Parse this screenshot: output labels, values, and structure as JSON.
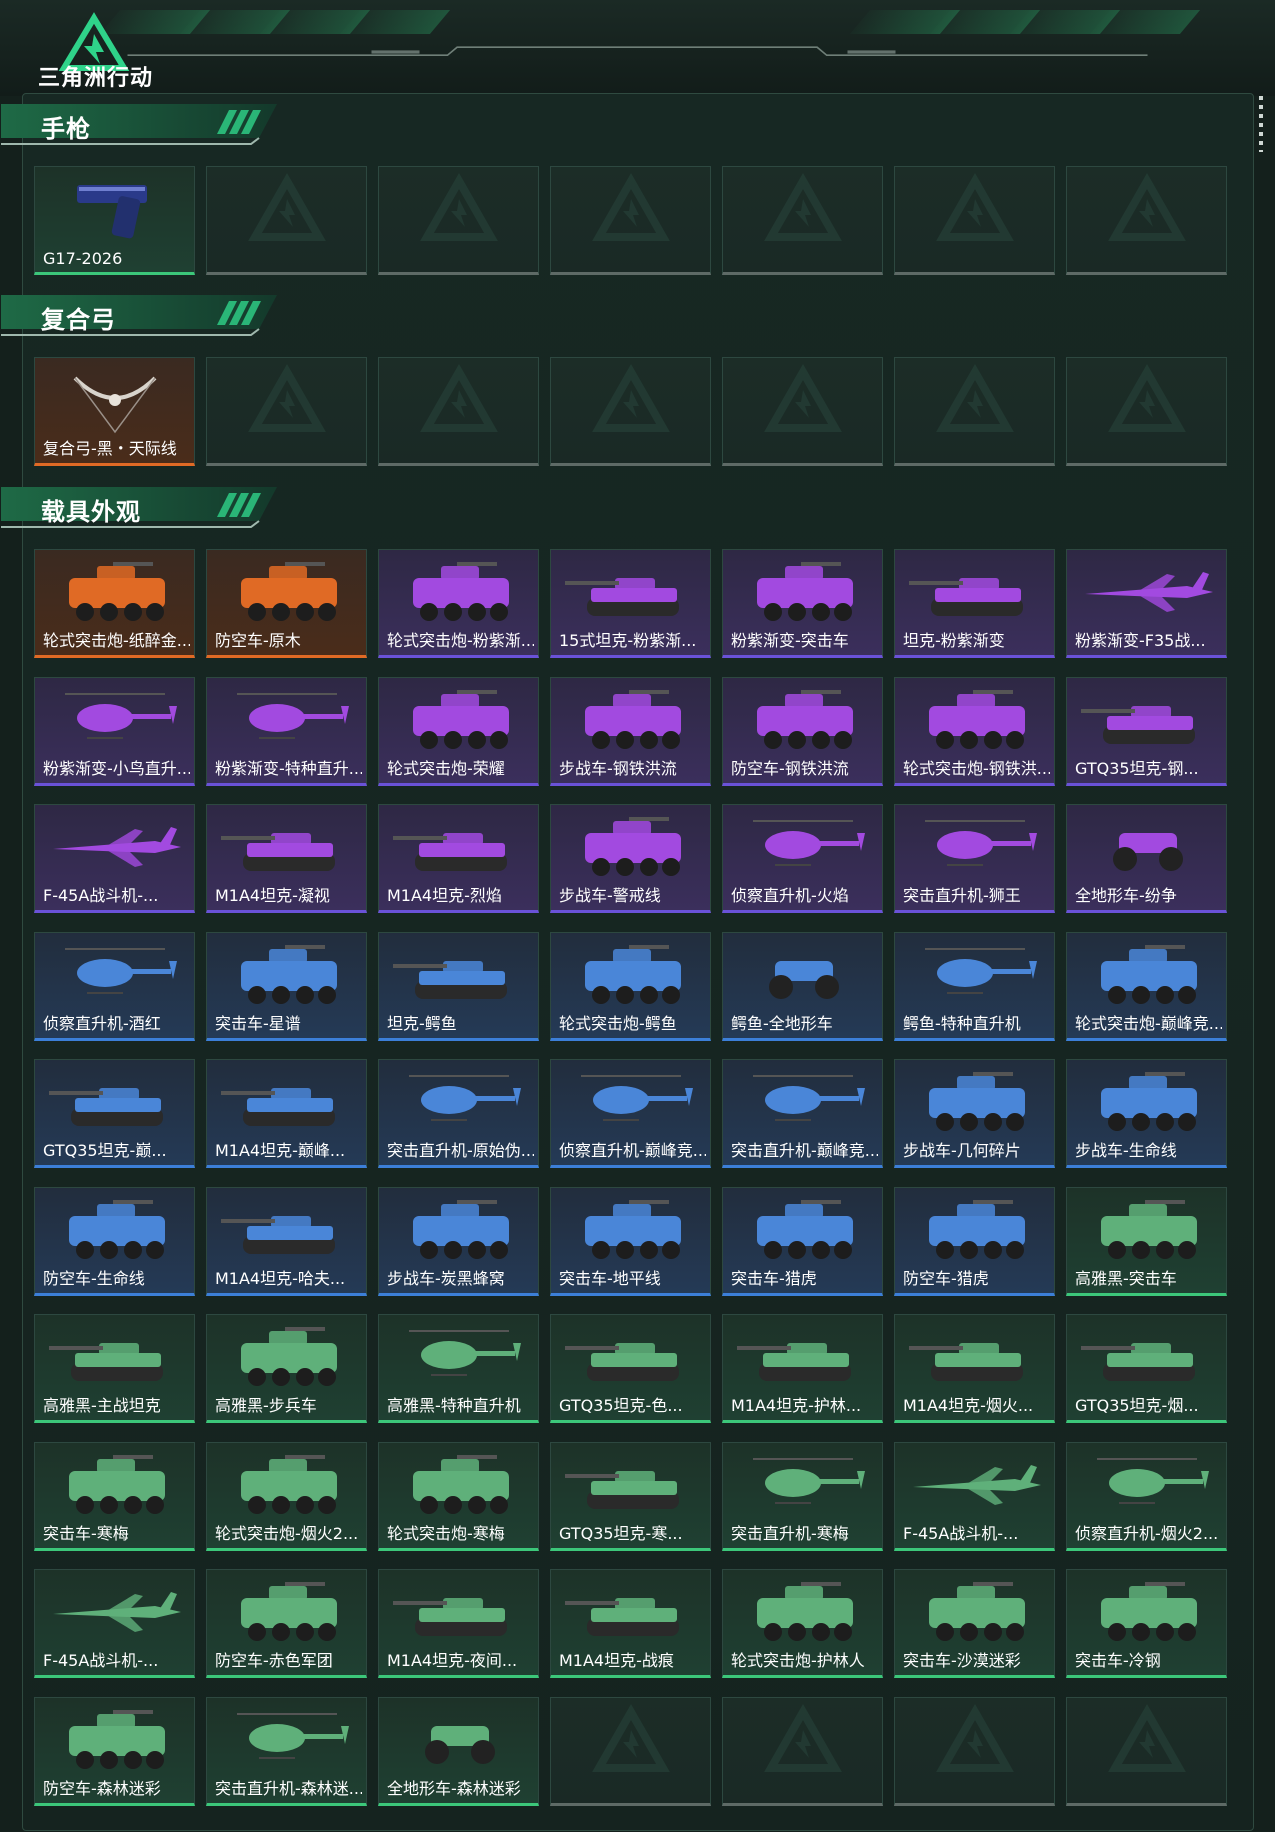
{
  "logo": {
    "text": "三角洲行动"
  },
  "sections": [
    {
      "title": "手枪",
      "items": [
        {
          "name": "G17-2026",
          "rarity": "green",
          "icon": "pistol-icon"
        },
        {
          "name": "",
          "rarity": "empty",
          "icon": "empty-slot-icon"
        },
        {
          "name": "",
          "rarity": "empty",
          "icon": "empty-slot-icon"
        },
        {
          "name": "",
          "rarity": "empty",
          "icon": "empty-slot-icon"
        },
        {
          "name": "",
          "rarity": "empty",
          "icon": "empty-slot-icon"
        },
        {
          "name": "",
          "rarity": "empty",
          "icon": "empty-slot-icon"
        },
        {
          "name": "",
          "rarity": "empty",
          "icon": "empty-slot-icon"
        }
      ]
    },
    {
      "title": "复合弓",
      "items": [
        {
          "name": "复合弓-黑・天际线",
          "rarity": "orange",
          "icon": "bow-icon"
        },
        {
          "name": "",
          "rarity": "empty",
          "icon": "empty-slot-icon"
        },
        {
          "name": "",
          "rarity": "empty",
          "icon": "empty-slot-icon"
        },
        {
          "name": "",
          "rarity": "empty",
          "icon": "empty-slot-icon"
        },
        {
          "name": "",
          "rarity": "empty",
          "icon": "empty-slot-icon"
        },
        {
          "name": "",
          "rarity": "empty",
          "icon": "empty-slot-icon"
        },
        {
          "name": "",
          "rarity": "empty",
          "icon": "empty-slot-icon"
        }
      ]
    },
    {
      "title": "载具外观",
      "items": [
        {
          "name": "轮式突击炮-纸醉金...",
          "rarity": "orange",
          "icon": "wheeled-vehicle-icon"
        },
        {
          "name": "防空车-原木",
          "rarity": "orange",
          "icon": "wheeled-vehicle-icon"
        },
        {
          "name": "轮式突击炮-粉紫渐...",
          "rarity": "purple",
          "icon": "wheeled-vehicle-icon"
        },
        {
          "name": "15式坦克-粉紫渐...",
          "rarity": "purple",
          "icon": "tank-icon"
        },
        {
          "name": "粉紫渐变-突击车",
          "rarity": "purple",
          "icon": "wheeled-vehicle-icon"
        },
        {
          "name": "坦克-粉紫渐变",
          "rarity": "purple",
          "icon": "tank-icon"
        },
        {
          "name": "粉紫渐变-F35战...",
          "rarity": "purple",
          "icon": "jet-icon"
        },
        {
          "name": "粉紫渐变-小鸟直升...",
          "rarity": "purple",
          "icon": "helicopter-icon"
        },
        {
          "name": "粉紫渐变-特种直升...",
          "rarity": "purple",
          "icon": "helicopter-icon"
        },
        {
          "name": "轮式突击炮-荣耀",
          "rarity": "purple",
          "icon": "wheeled-vehicle-icon"
        },
        {
          "name": "步战车-钢铁洪流",
          "rarity": "purple",
          "icon": "wheeled-vehicle-icon"
        },
        {
          "name": "防空车-钢铁洪流",
          "rarity": "purple",
          "icon": "wheeled-vehicle-icon"
        },
        {
          "name": "轮式突击炮-钢铁洪...",
          "rarity": "purple",
          "icon": "wheeled-vehicle-icon"
        },
        {
          "name": "GTQ35坦克-钢...",
          "rarity": "purple",
          "icon": "tank-icon"
        },
        {
          "name": "F-45A战斗机-...",
          "rarity": "purple",
          "icon": "jet-icon"
        },
        {
          "name": "M1A4坦克-凝视",
          "rarity": "purple",
          "icon": "tank-icon"
        },
        {
          "name": "M1A4坦克-烈焰",
          "rarity": "purple",
          "icon": "tank-icon"
        },
        {
          "name": "步战车-警戒线",
          "rarity": "purple",
          "icon": "wheeled-vehicle-icon"
        },
        {
          "name": "侦察直升机-火焰",
          "rarity": "purple",
          "icon": "helicopter-icon"
        },
        {
          "name": "突击直升机-狮王",
          "rarity": "purple",
          "icon": "helicopter-icon"
        },
        {
          "name": "全地形车-纷争",
          "rarity": "purple",
          "icon": "atv-icon"
        },
        {
          "name": "侦察直升机-酒红",
          "rarity": "blue",
          "icon": "helicopter-icon"
        },
        {
          "name": "突击车-星谱",
          "rarity": "blue",
          "icon": "wheeled-vehicle-icon"
        },
        {
          "name": "坦克-鳄鱼",
          "rarity": "blue",
          "icon": "tank-icon"
        },
        {
          "name": "轮式突击炮-鳄鱼",
          "rarity": "blue",
          "icon": "wheeled-vehicle-icon"
        },
        {
          "name": "鳄鱼-全地形车",
          "rarity": "blue",
          "icon": "atv-icon"
        },
        {
          "name": "鳄鱼-特种直升机",
          "rarity": "blue",
          "icon": "helicopter-icon"
        },
        {
          "name": "轮式突击炮-巅峰竞...",
          "rarity": "blue",
          "icon": "wheeled-vehicle-icon"
        },
        {
          "name": "GTQ35坦克-巅...",
          "rarity": "blue",
          "icon": "tank-icon"
        },
        {
          "name": "M1A4坦克-巅峰...",
          "rarity": "blue",
          "icon": "tank-icon"
        },
        {
          "name": "突击直升机-原始伪...",
          "rarity": "blue",
          "icon": "helicopter-icon"
        },
        {
          "name": "侦察直升机-巅峰竞...",
          "rarity": "blue",
          "icon": "helicopter-icon"
        },
        {
          "name": "突击直升机-巅峰竞...",
          "rarity": "blue",
          "icon": "helicopter-icon"
        },
        {
          "name": "步战车-几何碎片",
          "rarity": "blue",
          "icon": "wheeled-vehicle-icon"
        },
        {
          "name": "步战车-生命线",
          "rarity": "blue",
          "icon": "wheeled-vehicle-icon"
        },
        {
          "name": "防空车-生命线",
          "rarity": "blue",
          "icon": "wheeled-vehicle-icon"
        },
        {
          "name": "M1A4坦克-哈夫...",
          "rarity": "blue",
          "icon": "tank-icon"
        },
        {
          "name": "步战车-炭黑蜂窝",
          "rarity": "blue",
          "icon": "wheeled-vehicle-icon"
        },
        {
          "name": "突击车-地平线",
          "rarity": "blue",
          "icon": "wheeled-vehicle-icon"
        },
        {
          "name": "突击车-猎虎",
          "rarity": "blue",
          "icon": "wheeled-vehicle-icon"
        },
        {
          "name": "防空车-猎虎",
          "rarity": "blue",
          "icon": "wheeled-vehicle-icon"
        },
        {
          "name": "高雅黑-突击车",
          "rarity": "green",
          "icon": "wheeled-vehicle-icon"
        },
        {
          "name": "高雅黑-主战坦克",
          "rarity": "green",
          "icon": "tank-icon"
        },
        {
          "name": "高雅黑-步兵车",
          "rarity": "green",
          "icon": "wheeled-vehicle-icon"
        },
        {
          "name": "高雅黑-特种直升机",
          "rarity": "green",
          "icon": "helicopter-icon"
        },
        {
          "name": "GTQ35坦克-色...",
          "rarity": "green",
          "icon": "tank-icon"
        },
        {
          "name": "M1A4坦克-护林...",
          "rarity": "green",
          "icon": "tank-icon"
        },
        {
          "name": "M1A4坦克-烟火...",
          "rarity": "green",
          "icon": "tank-icon"
        },
        {
          "name": "GTQ35坦克-烟...",
          "rarity": "green",
          "icon": "tank-icon"
        },
        {
          "name": "突击车-寒梅",
          "rarity": "green",
          "icon": "wheeled-vehicle-icon"
        },
        {
          "name": "轮式突击炮-烟火2...",
          "rarity": "green",
          "icon": "wheeled-vehicle-icon"
        },
        {
          "name": "轮式突击炮-寒梅",
          "rarity": "green",
          "icon": "wheeled-vehicle-icon"
        },
        {
          "name": "GTQ35坦克-寒...",
          "rarity": "green",
          "icon": "tank-icon"
        },
        {
          "name": "突击直升机-寒梅",
          "rarity": "green",
          "icon": "helicopter-icon"
        },
        {
          "name": "F-45A战斗机-...",
          "rarity": "green",
          "icon": "jet-icon"
        },
        {
          "name": "侦察直升机-烟火2...",
          "rarity": "green",
          "icon": "helicopter-icon"
        },
        {
          "name": "F-45A战斗机-...",
          "rarity": "green",
          "icon": "jet-icon"
        },
        {
          "name": "防空车-赤色军团",
          "rarity": "green",
          "icon": "wheeled-vehicle-icon"
        },
        {
          "name": "M1A4坦克-夜间...",
          "rarity": "green",
          "icon": "tank-icon"
        },
        {
          "name": "M1A4坦克-战痕",
          "rarity": "green",
          "icon": "tank-icon"
        },
        {
          "name": "轮式突击炮-护林人",
          "rarity": "green",
          "icon": "wheeled-vehicle-icon"
        },
        {
          "name": "突击车-沙漠迷彩",
          "rarity": "green",
          "icon": "wheeled-vehicle-icon"
        },
        {
          "name": "突击车-冷钢",
          "rarity": "green",
          "icon": "wheeled-vehicle-icon"
        },
        {
          "name": "防空车-森林迷彩",
          "rarity": "green",
          "icon": "wheeled-vehicle-icon"
        },
        {
          "name": "突击直升机-森林迷...",
          "rarity": "green",
          "icon": "helicopter-icon"
        },
        {
          "name": "全地形车-森林迷彩",
          "rarity": "green",
          "icon": "atv-icon"
        },
        {
          "name": "",
          "rarity": "empty",
          "icon": "empty-slot-icon"
        },
        {
          "name": "",
          "rarity": "empty",
          "icon": "empty-slot-icon"
        },
        {
          "name": "",
          "rarity": "empty",
          "icon": "empty-slot-icon"
        },
        {
          "name": "",
          "rarity": "empty",
          "icon": "empty-slot-icon"
        }
      ]
    }
  ],
  "colors": {
    "background": "#14201c",
    "accent_green": "#3cc77a",
    "rarity_orange": "#e06a25",
    "rarity_purple": "#6a52d8",
    "rarity_blue": "#3c7fd8",
    "rarity_green": "#3cc77a"
  }
}
